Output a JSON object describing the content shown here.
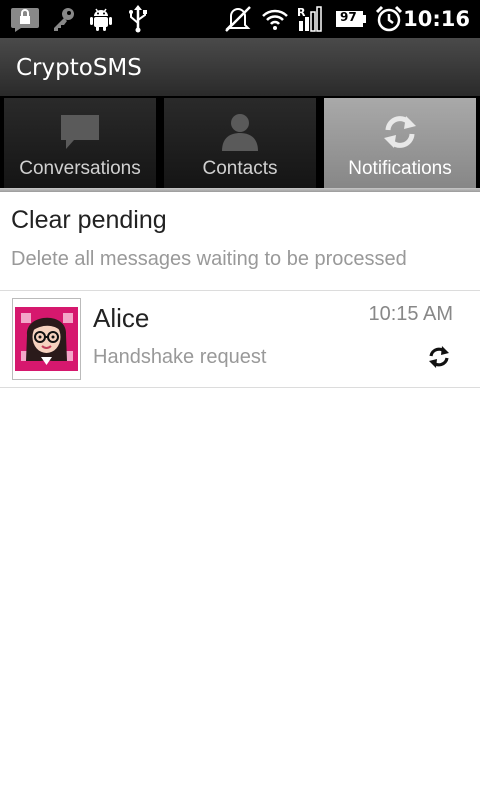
{
  "status_bar": {
    "time": "10:16",
    "battery_level": "97",
    "icons": [
      "lock-notification-icon",
      "key-icon",
      "android-debug-icon",
      "usb-icon",
      "silent-icon",
      "wifi-icon",
      "signal-roaming-icon",
      "battery-icon",
      "alarm-clock-icon"
    ]
  },
  "app": {
    "title": "CryptoSMS"
  },
  "tabs": [
    {
      "label": "Conversations",
      "icon": "chat-bubble-icon",
      "selected": false
    },
    {
      "label": "Contacts",
      "icon": "person-icon",
      "selected": false
    },
    {
      "label": "Notifications",
      "icon": "sync-icon",
      "selected": true
    }
  ],
  "clear_pending": {
    "title": "Clear pending",
    "subtitle": "Delete all messages waiting to be processed"
  },
  "notifications": [
    {
      "name": "Alice",
      "message": "Handshake request",
      "time": "10:15 AM",
      "icon": "sync-icon"
    }
  ],
  "colors": {
    "status_bar_bg": "#000000",
    "title_bar_bg": "#3a3a3a",
    "tab_selected_bg": "#999999",
    "tab_bg": "#1f1f1f",
    "avatar_accent": "#d6186e"
  }
}
